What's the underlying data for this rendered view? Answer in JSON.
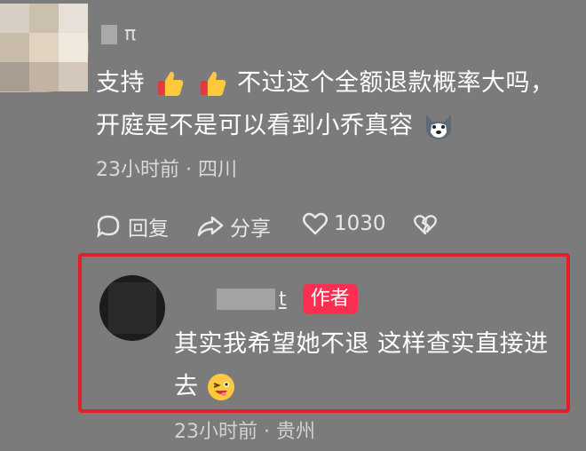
{
  "comment": {
    "username_suffix": "π",
    "line1_pre": "支持",
    "line1_post": "不过这个全额退款概率大吗，",
    "line2": "开庭是不是可以看到小乔真容",
    "meta": "23小时前 · 四川",
    "actions": {
      "reply": "回复",
      "share": "分享",
      "likes": "1030"
    },
    "icons": [
      "thumbs-up-icon",
      "thumbs-up-icon",
      "husky-emoji-icon",
      "comment-icon",
      "share-icon",
      "heart-icon",
      "dislike-icon"
    ]
  },
  "reply": {
    "username_suffix": "t",
    "badge": "作者",
    "line1": "其实我希望她不退 这样查实直接进",
    "line2": "去",
    "meta": "23小时前 · 贵州",
    "icons": [
      "wink-emoji-icon"
    ]
  },
  "colors": {
    "background": "#7b7b7c",
    "highlight_border": "#e32025",
    "badge": "#fc2f52"
  }
}
